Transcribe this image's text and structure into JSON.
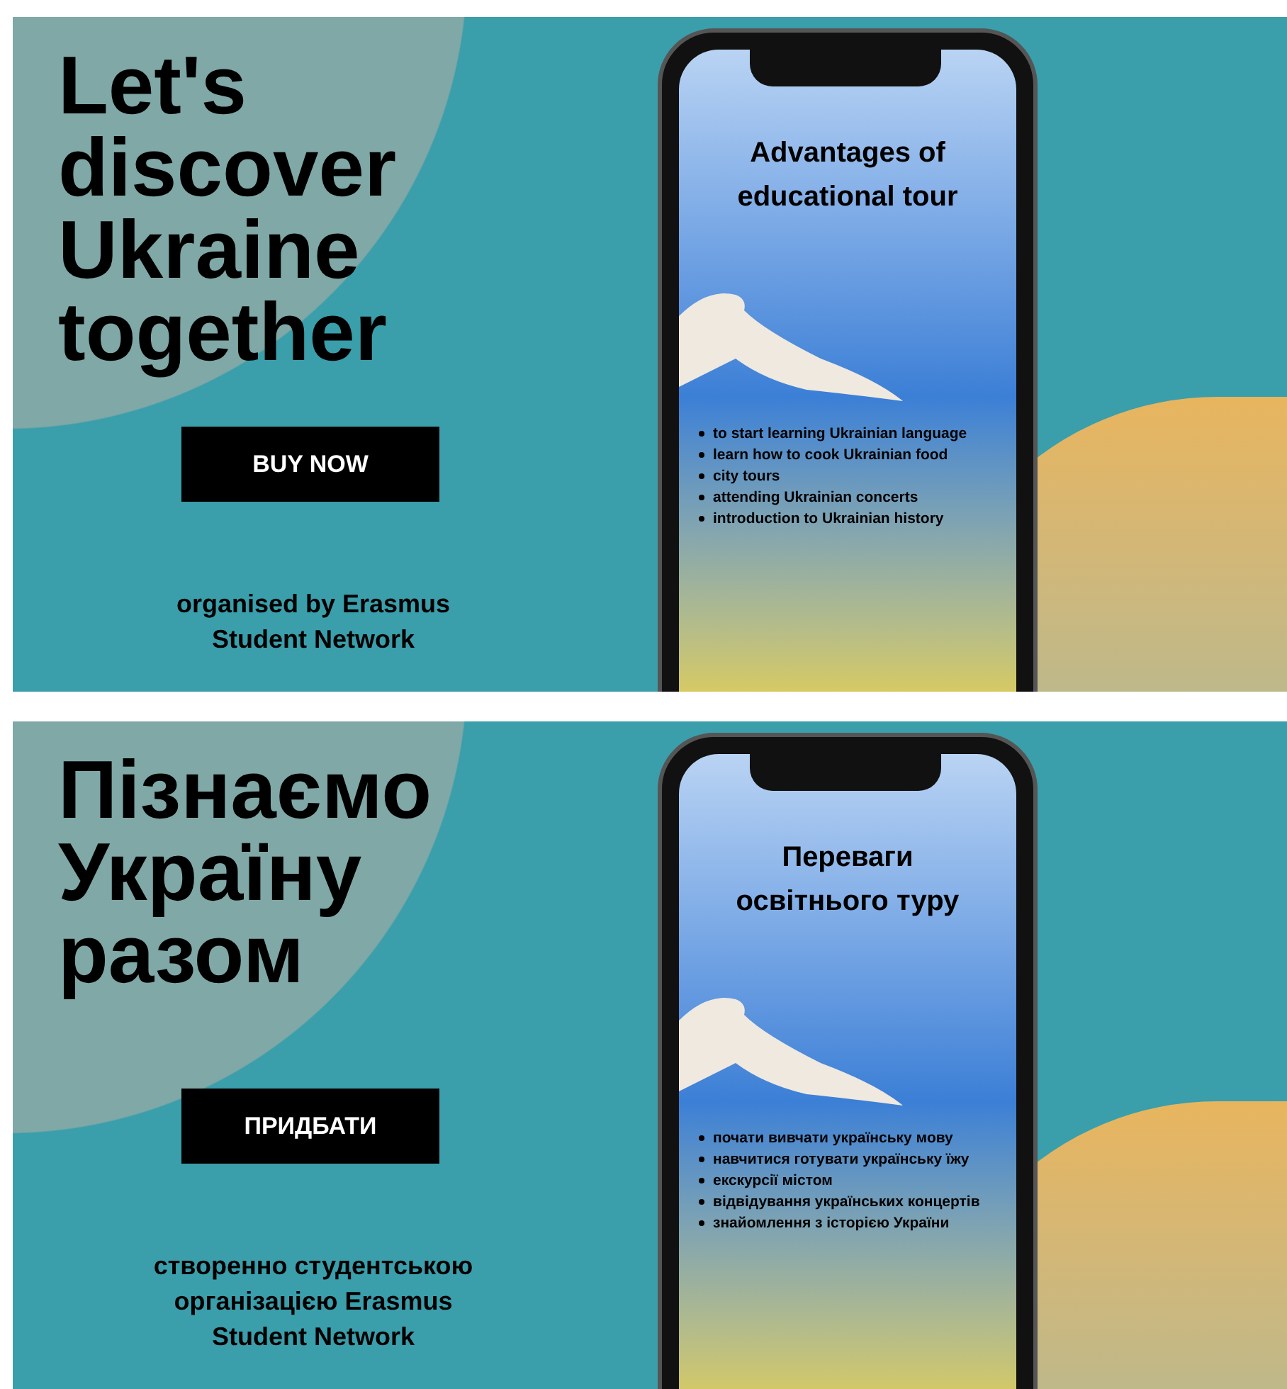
{
  "banners": [
    {
      "headline": "Let's discover Ukraine together",
      "button": "BUY NOW",
      "credit": "organised by Erasmus Student Network",
      "phone": {
        "title": "Advantages of educational tour",
        "bullets": [
          "to start learning  Ukrainian language",
          "learn how to cook Ukrainian food",
          "city tours",
          "attending Ukrainian concerts",
          "introduction to Ukrainian history"
        ]
      }
    },
    {
      "headline": "Пізнаємо Україну разом",
      "button": "ПРИДБАТИ",
      "credit": "створенно студентською організацією Erasmus Student Network",
      "phone": {
        "title": "Переваги освітнього туру",
        "bullets": [
          "почати вивчати українську мову",
          "навчитися готувати українську їжу",
          "екскурсії містом",
          "відвідування українських концертів",
          "знайомлення з історією України"
        ]
      }
    }
  ]
}
